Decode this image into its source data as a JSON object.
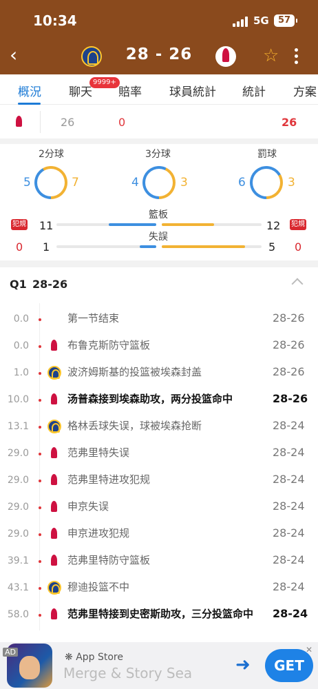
{
  "status_bar": {
    "time": "10:34",
    "network": "5G",
    "battery": "57"
  },
  "header": {
    "score": "28 - 26"
  },
  "tabs": [
    {
      "label": "概況",
      "active": true
    },
    {
      "label": "聊天",
      "badge": "9999+"
    },
    {
      "label": "賠率"
    },
    {
      "label": "球員統計"
    },
    {
      "label": "統計"
    },
    {
      "label": "方案"
    }
  ],
  "quarter_row": {
    "total": "26",
    "ot": "0",
    "final": "26"
  },
  "shooting": {
    "two_point": {
      "label": "2分球",
      "left": "5",
      "right": "7"
    },
    "three_point": {
      "label": "3分球",
      "left": "4",
      "right": "3"
    },
    "free_throw": {
      "label": "罰球",
      "left": "6",
      "right": "3"
    }
  },
  "fouls": {
    "tag": "犯規",
    "left": "0",
    "right": "0"
  },
  "rebounds": {
    "label": "籃板",
    "left": "11",
    "right": "12"
  },
  "turnovers": {
    "label": "失誤",
    "left": "1",
    "right": "5"
  },
  "quarter": {
    "label": "Q1",
    "score": "28-26"
  },
  "events": [
    {
      "time": "0.0",
      "team": "none",
      "text": "第一节结束",
      "score": "28-26",
      "bold": false
    },
    {
      "time": "0.0",
      "team": "hou",
      "text": "布鲁克斯防守篮板",
      "score": "28-26",
      "bold": false
    },
    {
      "time": "1.0",
      "team": "gsw",
      "text": "波济姆斯基的投篮被埃森封盖",
      "score": "28-26",
      "bold": false
    },
    {
      "time": "10.0",
      "team": "hou",
      "text": "汤普森接到埃森助攻，两分投篮命中",
      "score": "28-26",
      "bold": true
    },
    {
      "time": "13.1",
      "team": "gsw",
      "text": "格林丢球失误，球被埃森抢断",
      "score": "28-24",
      "bold": false
    },
    {
      "time": "29.0",
      "team": "hou",
      "text": "范弗里特失误",
      "score": "28-24",
      "bold": false
    },
    {
      "time": "29.0",
      "team": "hou",
      "text": "范弗里特进攻犯规",
      "score": "28-24",
      "bold": false
    },
    {
      "time": "29.0",
      "team": "hou",
      "text": "申京失误",
      "score": "28-24",
      "bold": false
    },
    {
      "time": "29.0",
      "team": "hou",
      "text": "申京进攻犯规",
      "score": "28-24",
      "bold": false
    },
    {
      "time": "39.1",
      "team": "hou",
      "text": "范弗里特防守篮板",
      "score": "28-24",
      "bold": false
    },
    {
      "time": "43.1",
      "team": "gsw",
      "text": "穆迪投篮不中",
      "score": "28-24",
      "bold": false
    },
    {
      "time": "58.0",
      "team": "hou",
      "text": "范弗里特接到史密斯助攻，三分投篮命中",
      "score": "28-24",
      "bold": true
    }
  ],
  "ad": {
    "tag": "AD",
    "store": "App Store",
    "title": "Merge & Story  Sea",
    "cta": "GET"
  },
  "colors": {
    "header": "#8a4a1d",
    "accent": "#1d7bd6",
    "away": "#3d8fe0",
    "home": "#f2b233",
    "foul": "#d9282f"
  }
}
